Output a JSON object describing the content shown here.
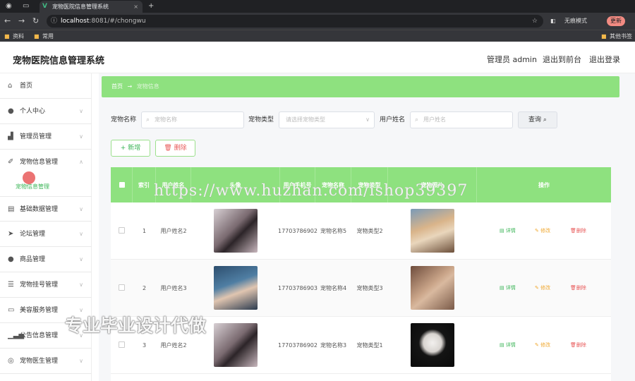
{
  "browser": {
    "tab_title": "宠物医院信息管理系统",
    "tab_close": "×",
    "new_tab": "+",
    "url_host": "localhost",
    "url_rest": ":8081/#/chongwu",
    "incognito_label": "无痕模式",
    "update_label": "更新",
    "bookmarks": [
      "资料",
      "常用"
    ],
    "other_bookmarks": "其他书签"
  },
  "header": {
    "title": "宠物医院信息管理系统",
    "user": "管理员 admin",
    "back_front": "退出到前台",
    "logout": "退出登录"
  },
  "sidebar": {
    "items": [
      {
        "label": "首页",
        "icon": "home-icon"
      },
      {
        "label": "个人中心",
        "icon": "user-icon"
      },
      {
        "label": "管理员管理",
        "icon": "chart-icon"
      },
      {
        "label": "宠物信息管理",
        "icon": "paw-icon"
      },
      {
        "label": "基础数据管理",
        "icon": "data-icon"
      },
      {
        "label": "论坛管理",
        "icon": "send-icon"
      },
      {
        "label": "商品管理",
        "icon": "user-icon"
      },
      {
        "label": "宠物挂号管理",
        "icon": "list-icon"
      },
      {
        "label": "美容服务管理",
        "icon": "service-icon"
      },
      {
        "label": "公告信息管理",
        "icon": "bar-icon"
      },
      {
        "label": "宠物医生管理",
        "icon": "compass-icon"
      }
    ],
    "active_sub": "宠物信息管理"
  },
  "breadcrumb": {
    "home": "首页",
    "arrow": "→",
    "current": "宠物信息"
  },
  "search": {
    "name_label": "宠物名称",
    "name_placeholder": "宠物名称",
    "type_label": "宠物类型",
    "type_placeholder": "请选择宠物类型",
    "user_label": "用户姓名",
    "user_placeholder": "用户姓名",
    "query_button": "查询"
  },
  "actions": {
    "add": "+ 新增",
    "delete": "删除"
  },
  "table": {
    "headers": [
      "索引",
      "用户姓名",
      "头像",
      "用户手机号",
      "宠物名称",
      "宠物类型",
      "宠物照片",
      "操作"
    ],
    "rows": [
      {
        "index": "1",
        "user": "用户姓名2",
        "phone": "17703786902",
        "pet_name": "宠物名称5",
        "pet_type": "宠物类型2"
      },
      {
        "index": "2",
        "user": "用户姓名3",
        "phone": "17703786903",
        "pet_name": "宠物名称4",
        "pet_type": "宠物类型3"
      },
      {
        "index": "3",
        "user": "用户姓名2",
        "phone": "17703786902",
        "pet_name": "宠物名称3",
        "pet_type": "宠物类型1"
      }
    ],
    "op_detail": "详情",
    "op_edit": "修改",
    "op_delete": "删除"
  },
  "watermarks": {
    "url": "https://www.huzhan.com/ishop39397",
    "text": "专业毕业设计代做"
  }
}
